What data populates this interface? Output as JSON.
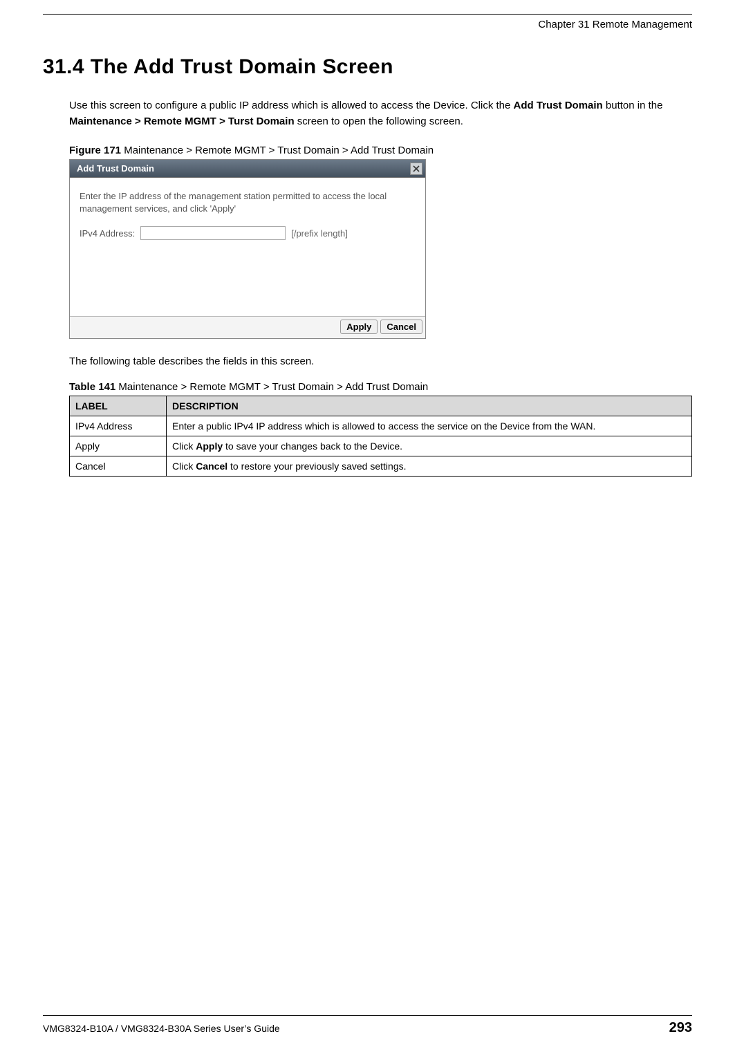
{
  "header": {
    "chapter": "Chapter 31 Remote Management"
  },
  "section_heading": "31.4  The Add Trust Domain Screen",
  "intro": {
    "t1": "Use this screen to configure a public IP address which is allowed to access the Device. Click the ",
    "b1": "Add Trust Domain",
    "t2": " button in the ",
    "b2": "Maintenance > Remote MGMT > Turst Domain",
    "t3": " screen to open the following screen."
  },
  "figure_caption": {
    "label": "Figure 171",
    "rest": "   Maintenance > Remote MGMT > Trust Domain > Add Trust Domain"
  },
  "dialog": {
    "title": "Add Trust Domain",
    "instruction": "Enter the IP address of the management station permitted to access the local management services, and click 'Apply'",
    "field_label": "IPv4 Address:",
    "field_value": "",
    "suffix": "[/prefix length]",
    "apply": "Apply",
    "cancel": "Cancel"
  },
  "post_figure": "The following table describes the fields in this screen.",
  "table_caption": {
    "label": "Table 141",
    "rest": "   Maintenance > Remote MGMT > Trust Domain > Add Trust Domain"
  },
  "table": {
    "head": {
      "label": "LABEL",
      "desc": "DESCRIPTION"
    },
    "rows": [
      {
        "label": "IPv4 Address",
        "desc_pre": "Enter a public IPv4 IP address which is allowed to access the service on the Device from the WAN.",
        "bold": "",
        "desc_post": ""
      },
      {
        "label": "Apply",
        "desc_pre": "Click ",
        "bold": "Apply",
        "desc_post": " to save your changes back to the Device."
      },
      {
        "label": "Cancel",
        "desc_pre": "Click ",
        "bold": "Cancel",
        "desc_post": " to restore your previously saved settings."
      }
    ]
  },
  "footer": {
    "guide": "VMG8324-B10A / VMG8324-B30A Series User’s Guide",
    "page": "293"
  }
}
